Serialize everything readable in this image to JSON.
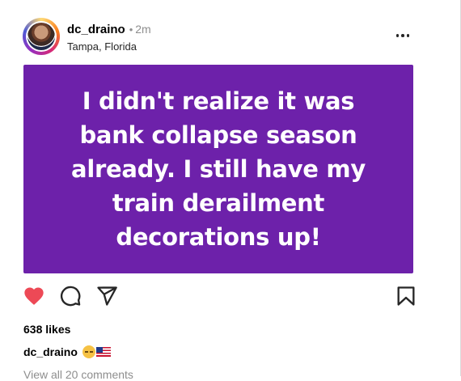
{
  "post": {
    "username": "dc_draino",
    "separator": "•",
    "time": "2m",
    "location": "Tampa, Florida",
    "more_icon": "more-horizontal-icon",
    "media_text": "I didn't realize it was bank collapse season already. I still have my train derailment decorations up!",
    "media_background": "#6d21aa",
    "actions": {
      "like_icon": "heart-filled-icon",
      "comment_icon": "comment-icon",
      "share_icon": "send-icon",
      "save_icon": "bookmark-icon",
      "like_color": "#ed4956"
    },
    "likes": "638 likes",
    "caption": {
      "username": "dc_draino",
      "emojis": [
        "sad-face-emoji",
        "us-flag-emoji"
      ]
    },
    "comments_link": "View all 20 comments"
  }
}
